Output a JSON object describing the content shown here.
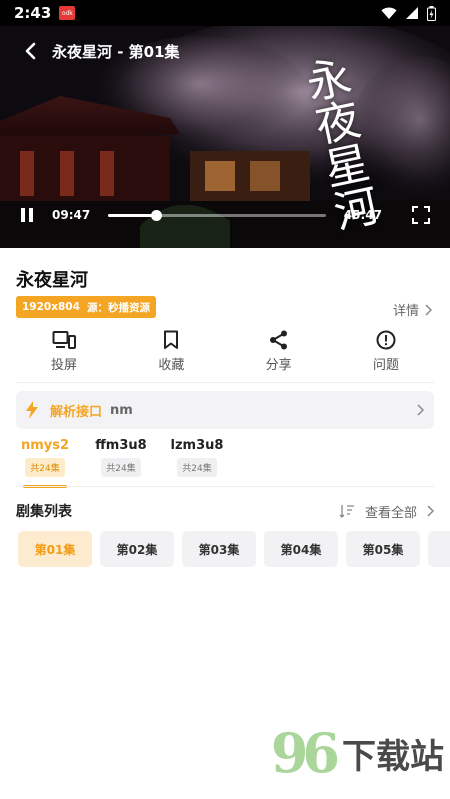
{
  "status_bar": {
    "time": "2:43",
    "badge": "odk"
  },
  "player": {
    "title": "永夜星河 - 第01集",
    "calligraphy": "永夜星河",
    "current_time": "09:47",
    "total_time": "45:47",
    "progress": 0.22
  },
  "show": {
    "title": "永夜星河",
    "tags": [
      "1920x804",
      "源：秒播资源"
    ],
    "detail_label": "详情"
  },
  "actions": [
    {
      "label": "投屏",
      "icon": "cast-icon"
    },
    {
      "label": "收藏",
      "icon": "bookmark-icon"
    },
    {
      "label": "分享",
      "icon": "share-icon"
    },
    {
      "label": "问题",
      "icon": "alert-icon"
    }
  ],
  "parse": {
    "label": "解析接口",
    "value": "nm"
  },
  "sources": [
    {
      "name": "nmys2",
      "count": "共24集"
    },
    {
      "name": "ffm3u8",
      "count": "共24集"
    },
    {
      "name": "lzm3u8",
      "count": "共24集"
    }
  ],
  "episode_list": {
    "title": "剧集列表",
    "view_all": "查看全部",
    "episodes": [
      "第01集",
      "第02集",
      "第03集",
      "第04集",
      "第05集"
    ]
  },
  "watermark": {
    "digits": "96",
    "text": "下载站"
  },
  "colors": {
    "accent": "#f5a524",
    "active_bg": "#fdebd0"
  }
}
